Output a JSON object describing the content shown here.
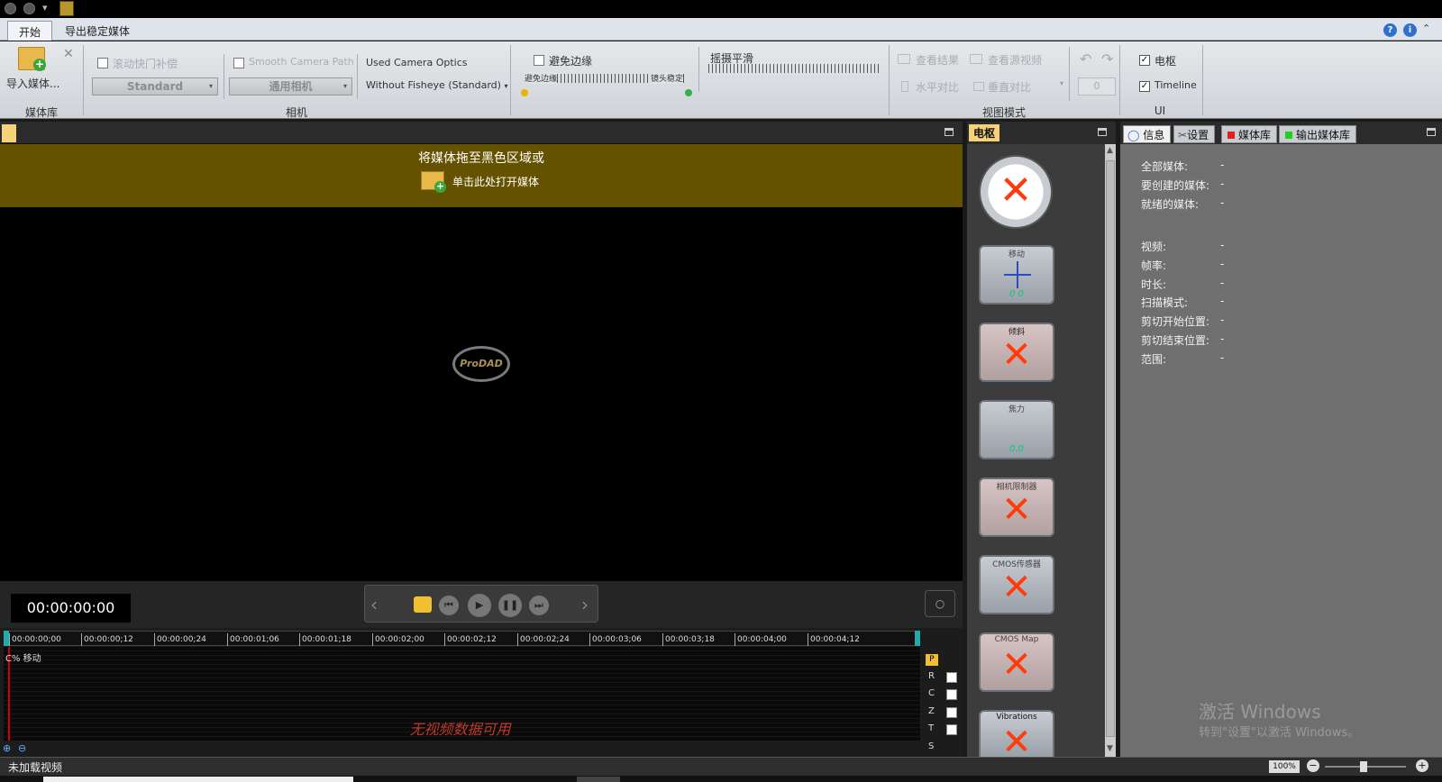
{
  "app": {
    "tabs": [
      "开始",
      "导出稳定媒体"
    ]
  },
  "ribbon": {
    "media_group": {
      "import_label": "导入媒体...",
      "group_label": "媒体库"
    },
    "camera_group": {
      "rolling_shutter": "滚动快门补偿",
      "rolling_shutter_mode": "Standard",
      "smooth_camera_path": "Smooth Camera Path",
      "camera_model": "通用相机",
      "used_camera_optics": "Used Camera Optics",
      "optics_value": "Without Fisheye (Standard)",
      "group_label": "相机"
    },
    "stabilize_group": {
      "avoid_border": "避免边缘",
      "left_label": "避免边缘",
      "right_label": "镜头稳定",
      "pan_smooth": "摇摄平滑"
    },
    "view_group": {
      "view_result": "查看结果",
      "view_source": "查看源视频",
      "horizontal_compare": "水平对比",
      "vertical_compare": "垂直对比",
      "group_label": "视图模式",
      "counter": "0"
    },
    "ui_group": {
      "dashboard": "电枢",
      "timeline": "Timeline",
      "group_label": "UI"
    }
  },
  "preview": {
    "drop_text": "将媒体拖至黑色区域或",
    "open_text": "单击此处打开媒体",
    "logo": "ProDAD"
  },
  "transport": {
    "timecode": "00:00:00:00"
  },
  "timeline": {
    "ticks": [
      "00:00:00;00",
      "00:00:00;12",
      "00:00:00;24",
      "00:00:01;06",
      "00:00:01;18",
      "00:00:02;00",
      "00:00:02;12",
      "00:00:02;24",
      "00:00:03;06",
      "00:00:03;18",
      "00:00:04;00",
      "00:00:04;12"
    ],
    "track_label": "C% 移动",
    "no_data": "无视频数据可用",
    "side_letters": [
      "P",
      "R",
      "C",
      "Z",
      "T",
      "S"
    ]
  },
  "dashboard": {
    "tab": "电枢",
    "tools": [
      {
        "name": "",
        "state": "x"
      },
      {
        "name": "移动",
        "state": "val",
        "value": "0  0"
      },
      {
        "name": "倾斜",
        "state": "x"
      },
      {
        "name": "焦力",
        "state": "val",
        "value": "0.0"
      },
      {
        "name": "相机限制器",
        "state": "x"
      },
      {
        "name": "CMOS传感器",
        "state": "x"
      },
      {
        "name": "CMOS Map",
        "state": "x"
      },
      {
        "name": "Vibrations",
        "state": "x"
      }
    ]
  },
  "info_panel": {
    "tabs": [
      "信息",
      "设置",
      "媒体库",
      "输出媒体库"
    ],
    "rows1": [
      {
        "label": "全部媒体:",
        "value": "-"
      },
      {
        "label": "要创建的媒体:",
        "value": "-"
      },
      {
        "label": "就绪的媒体:",
        "value": "-"
      }
    ],
    "rows2": [
      {
        "label": "视频:",
        "value": "-"
      },
      {
        "label": "帧率:",
        "value": "-"
      },
      {
        "label": "时长:",
        "value": "-"
      },
      {
        "label": "扫描模式:",
        "value": "-"
      },
      {
        "label": "剪切开始位置:",
        "value": "-"
      },
      {
        "label": "剪切结束位置:",
        "value": "-"
      },
      {
        "label": "范围:",
        "value": "-"
      }
    ],
    "watermark_title": "激活 Windows",
    "watermark_sub": "转到\"设置\"以激活 Windows。"
  },
  "status": {
    "text": "未加载视频",
    "zoom": "100%"
  }
}
